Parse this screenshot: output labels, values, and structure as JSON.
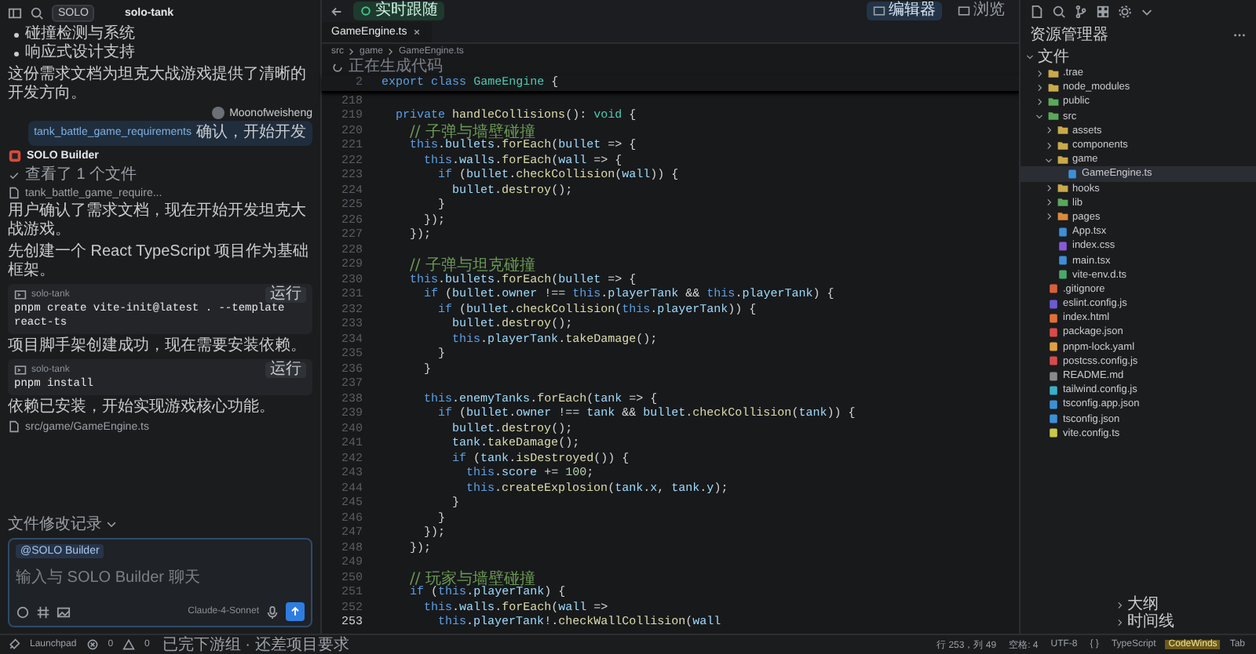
{
  "app": {
    "mode_label": "SOLO",
    "project": "solo-tank"
  },
  "chat": {
    "messages": [
      {
        "kind": "bullets",
        "items": [
          "碰撞检测与系统",
          "响应式设计支持"
        ]
      },
      {
        "kind": "text",
        "text": "这份需求文档为坦克大战游戏提供了清晰的开发方向。"
      },
      {
        "kind": "user",
        "author": "Moonofweisheng",
        "file": "tank_battle_game_requirements",
        "text": "确认，开始开发"
      },
      {
        "kind": "agent",
        "name": "SOLO Builder"
      },
      {
        "kind": "status",
        "text": "查看了 1 个文件"
      },
      {
        "kind": "file_ref",
        "text": "tank_battle_game_require..."
      },
      {
        "kind": "text",
        "text": "用户确认了需求文档，现在开始开发坦克大战游戏。"
      },
      {
        "kind": "text",
        "text": "先创建一个 React TypeScript 项目作为基础框架。"
      },
      {
        "kind": "code",
        "label": "solo-tank",
        "action": "运行",
        "code": "pnpm create vite-init@latest . --template react-ts"
      },
      {
        "kind": "text",
        "text": "项目脚手架创建成功，现在需要安装依赖。"
      },
      {
        "kind": "code",
        "label": "solo-tank",
        "action": "运行",
        "code": "pnpm install"
      },
      {
        "kind": "text",
        "text": "依赖已安装，开始实现游戏核心功能。"
      },
      {
        "kind": "file_ref",
        "text": "src/game/GameEngine.ts"
      }
    ],
    "history_label": "文件修改记录",
    "composer": {
      "agent": "@SOLO Builder",
      "placeholder": "输入与 SOLO Builder 聊天",
      "model": "Claude-4-Sonnet"
    }
  },
  "editor": {
    "follow_label": "实时跟随",
    "views": [
      {
        "label": "编辑器",
        "selected": true
      },
      {
        "label": "浏览",
        "selected": false
      }
    ],
    "tabs": [
      {
        "label": "GameEngine.ts",
        "selected": true
      }
    ],
    "breadcrumb": [
      "src",
      "game",
      "GameEngine.ts"
    ],
    "generating": "正在生成代码",
    "sticky": {
      "number": "2",
      "code": "export class GameEngine {"
    },
    "lines": [
      {
        "number": "218",
        "active": false
      },
      {
        "number": "219",
        "code": "  private handleCollisions(): void {",
        "active": false
      },
      {
        "number": "220",
        "code": "    // 子弹与墙壁碰撞",
        "active": false
      },
      {
        "number": "221",
        "code": "    this.bullets.forEach(bullet => {",
        "active": false
      },
      {
        "number": "222",
        "code": "      this.walls.forEach(wall => {",
        "active": false
      },
      {
        "number": "223",
        "code": "        if (bullet.checkCollision(wall)) {",
        "active": false
      },
      {
        "number": "224",
        "code": "          bullet.destroy();",
        "active": false
      },
      {
        "number": "225",
        "code": "        }",
        "active": false
      },
      {
        "number": "226",
        "code": "      });",
        "active": false
      },
      {
        "number": "227",
        "code": "    });",
        "active": false
      },
      {
        "number": "228",
        "active": false
      },
      {
        "number": "229",
        "code": "    // 子弹与坦克碰撞",
        "active": false
      },
      {
        "number": "230",
        "code": "    this.bullets.forEach(bullet => {",
        "active": false
      },
      {
        "number": "231",
        "code": "      if (bullet.owner !== this.playerTank && this.playerTank) {",
        "active": false
      },
      {
        "number": "232",
        "code": "        if (bullet.checkCollision(this.playerTank)) {",
        "active": false
      },
      {
        "number": "233",
        "code": "          bullet.destroy();",
        "active": false
      },
      {
        "number": "234",
        "code": "          this.playerTank.takeDamage();",
        "active": false
      },
      {
        "number": "235",
        "code": "        }",
        "active": false
      },
      {
        "number": "236",
        "code": "      }",
        "active": false
      },
      {
        "number": "237",
        "active": false
      },
      {
        "number": "238",
        "code": "      this.enemyTanks.forEach(tank => {",
        "active": false
      },
      {
        "number": "239",
        "code": "        if (bullet.owner !== tank && bullet.checkCollision(tank)) {",
        "active": false
      },
      {
        "number": "240",
        "code": "          bullet.destroy();",
        "active": false
      },
      {
        "number": "241",
        "code": "          tank.takeDamage();",
        "active": false
      },
      {
        "number": "242",
        "code": "          if (tank.isDestroyed()) {",
        "active": false
      },
      {
        "number": "243",
        "code": "            this.score += 100;",
        "active": false
      },
      {
        "number": "244",
        "code": "            this.createExplosion(tank.x, tank.y);",
        "active": false
      },
      {
        "number": "245",
        "code": "          }",
        "active": false
      },
      {
        "number": "246",
        "code": "        }",
        "active": false
      },
      {
        "number": "247",
        "code": "      });",
        "active": false
      },
      {
        "number": "248",
        "code": "    });",
        "active": false
      },
      {
        "number": "249",
        "active": false
      },
      {
        "number": "250",
        "code": "    // 玩家与墙壁碰撞",
        "active": false
      },
      {
        "number": "251",
        "code": "    if (this.playerTank) {",
        "active": false
      },
      {
        "number": "252",
        "code": "      this.walls.forEach(wall =>",
        "active": false
      },
      {
        "number": "253",
        "code": "        this.playerTank!.checkWallCollision(wall",
        "active": true
      }
    ]
  },
  "explorer": {
    "title": "资源管理器",
    "tree": [
      {
        "label": "文件",
        "kind": "section",
        "expanded": true,
        "selected": false,
        "children": [
          {
            "label": ".trae",
            "kind": "folder",
            "color": "#c9a94a",
            "expanded": false,
            "selected": false
          },
          {
            "label": "node_modules",
            "kind": "folder",
            "color": "#c9a94a",
            "expanded": false,
            "selected": false
          },
          {
            "label": "public",
            "kind": "folder",
            "color": "#5aa85a",
            "expanded": false,
            "selected": false
          },
          {
            "label": "src",
            "kind": "folder",
            "color": "#5aa85a",
            "expanded": true,
            "selected": false,
            "children": [
              {
                "label": "assets",
                "kind": "folder",
                "color": "#c9a94a",
                "expanded": false,
                "selected": false
              },
              {
                "label": "components",
                "kind": "folder",
                "color": "#c9a94a",
                "expanded": false,
                "selected": false
              },
              {
                "label": "game",
                "kind": "folder",
                "color": "#c9a94a",
                "expanded": true,
                "selected": false,
                "children": [
                  {
                    "label": "GameEngine.ts",
                    "kind": "file",
                    "color": "#3d8fd6",
                    "selected": true
                  }
                ]
              },
              {
                "label": "hooks",
                "kind": "folder",
                "color": "#c9a94a",
                "expanded": false,
                "selected": false
              },
              {
                "label": "lib",
                "kind": "folder",
                "color": "#5aa85a",
                "expanded": false,
                "selected": false
              },
              {
                "label": "pages",
                "kind": "folder",
                "color": "#d98a3a",
                "expanded": false,
                "selected": false
              },
              {
                "label": "App.tsx",
                "kind": "file",
                "color": "#3d8fd6",
                "selected": false
              },
              {
                "label": "index.css",
                "kind": "file",
                "color": "#8a5ad6",
                "selected": false
              },
              {
                "label": "main.tsx",
                "kind": "file",
                "color": "#3d8fd6",
                "selected": false
              },
              {
                "label": "vite-env.d.ts",
                "kind": "file",
                "color": "#4aa86a",
                "selected": false
              }
            ]
          },
          {
            "label": ".gitignore",
            "kind": "file",
            "color": "#d9603a",
            "selected": false
          },
          {
            "label": "eslint.config.js",
            "kind": "file",
            "color": "#6a5ad6",
            "selected": false
          },
          {
            "label": "index.html",
            "kind": "file",
            "color": "#e0703a",
            "selected": false
          },
          {
            "label": "package.json",
            "kind": "file",
            "color": "#d94a4a",
            "selected": false
          },
          {
            "label": "pnpm-lock.yaml",
            "kind": "file",
            "color": "#e0a040",
            "selected": false
          },
          {
            "label": "postcss.config.js",
            "kind": "file",
            "color": "#d94a4a",
            "selected": false
          },
          {
            "label": "README.md",
            "kind": "file",
            "color": "#8a8a8a",
            "selected": false
          },
          {
            "label": "tailwind.config.js",
            "kind": "file",
            "color": "#3ab0c9",
            "selected": false
          },
          {
            "label": "tsconfig.app.json",
            "kind": "file",
            "color": "#3d8fd6",
            "selected": false
          },
          {
            "label": "tsconfig.json",
            "kind": "file",
            "color": "#3d8fd6",
            "selected": false
          },
          {
            "label": "vite.config.ts",
            "kind": "file",
            "color": "#c9c94a",
            "selected": false
          }
        ]
      }
    ],
    "panels": [
      "大纲",
      "时间线"
    ]
  },
  "status_bar": {
    "left": [
      {
        "kind": "launchpad",
        "text": "Launchpad"
      },
      {
        "kind": "errors",
        "text": "0"
      },
      {
        "kind": "warnings",
        "text": "0"
      },
      {
        "kind": "text",
        "text": "已完下游组 · 还差项目要求"
      }
    ],
    "right": [
      {
        "text": "行 253，列 49",
        "highlighted": false
      },
      {
        "text": "空格: 4",
        "highlighted": false
      },
      {
        "text": "UTF-8",
        "highlighted": false
      },
      {
        "text": "{ }",
        "highlighted": false
      },
      {
        "text": "TypeScript",
        "highlighted": false
      },
      {
        "text": "CodeWinds",
        "highlighted": true
      },
      {
        "text": "Tab",
        "highlighted": false
      }
    ]
  }
}
